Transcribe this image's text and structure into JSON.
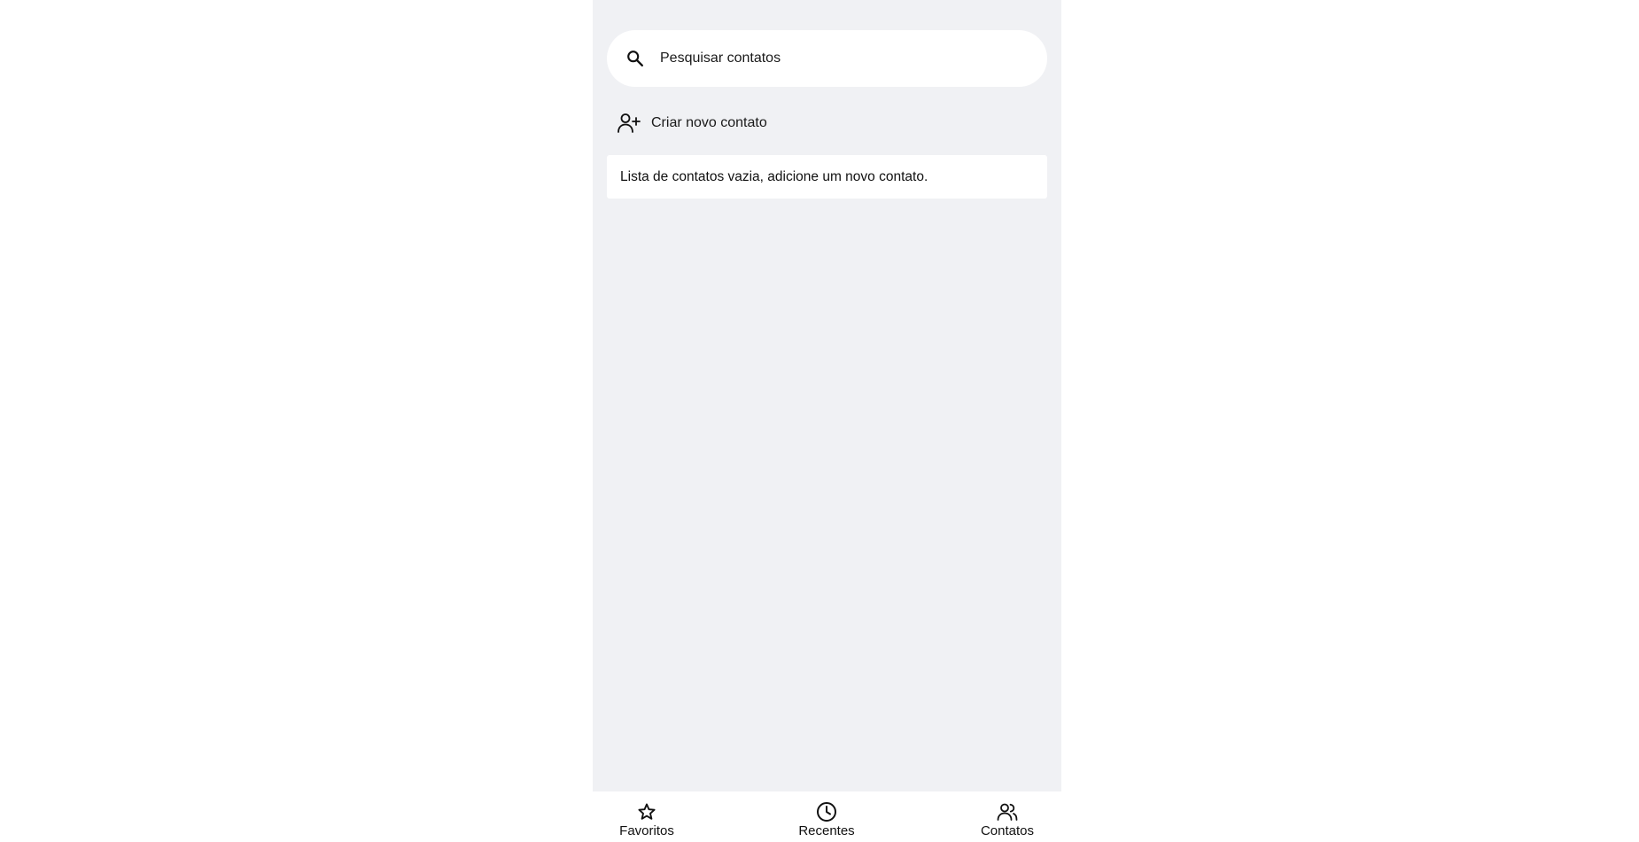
{
  "search": {
    "placeholder": "Pesquisar contatos",
    "icon": "search-icon"
  },
  "create_contact": {
    "label": "Criar novo contato",
    "icon": "person-add-icon"
  },
  "contacts_list": {
    "empty_message": "Lista de contatos vazia, adicione um novo contato."
  },
  "bottom_nav": {
    "items": [
      {
        "label": "Favoritos",
        "icon": "star-icon"
      },
      {
        "label": "Recentes",
        "icon": "clock-icon"
      },
      {
        "label": "Contatos",
        "icon": "people-icon"
      }
    ]
  },
  "colors": {
    "background": "#f0f1f4",
    "surface": "#ffffff",
    "text": "#111111"
  }
}
